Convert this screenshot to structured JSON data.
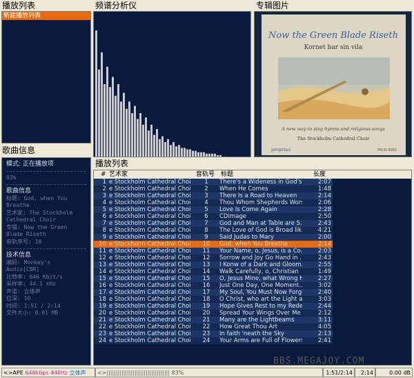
{
  "panels": {
    "playlist_title": "播放列表",
    "spectrum_title": "频谱分析仪",
    "album_title": "专辑图片",
    "song_info_title": "歌曲信息",
    "table_title": "播放列表"
  },
  "playlist": {
    "items": [
      "新建播放列表"
    ]
  },
  "album": {
    "title": "Now the Green Blade Riseth",
    "subtitle": "Kornet har sin vila",
    "tagline": "A new way to sing hymns and religious songs",
    "performer": "The Stockholm Cathedral Choir",
    "label": "proprius",
    "catalog": "PRCD 9092"
  },
  "song_info": {
    "mode_label": "模式:",
    "mode_value": "正在播放项",
    "counter": "03%",
    "song_heading": "歌曲信息",
    "title_label": "标题:",
    "title_value": "God, when You Breathe",
    "artist_label": "艺术家:",
    "artist_value": "The Stockholm Cathedral Choir",
    "album_label": "专辑:",
    "album_value": "Now the Green Blade Riseth",
    "track_label": "音轨序号:",
    "track_value": "10",
    "tech_heading": "技术信息",
    "codec_label": "编码:",
    "codec_value": "Monkey's Audio[CBR]",
    "bitrate_label": "比特率:",
    "bitrate_value": "646 Kbit/s",
    "samplerate_label": "采样率:",
    "samplerate_value": "44.1 kHz",
    "channels_label": "声道:",
    "channels_value": "立体声",
    "bits_label": "位深:",
    "bits_value": "16",
    "time_label": "时间:",
    "time_value": "1:51 / 2:14",
    "filesize_label": "文件大小:",
    "filesize_value": "0.01 MB"
  },
  "table": {
    "headers": {
      "num": "#",
      "artist": "艺术家",
      "track": "音轨号",
      "title": "标题",
      "length": "长度"
    },
    "selected_index": 9,
    "rows": [
      {
        "num": "1",
        "artist": "e Stockholm Cathedral Choir",
        "track": "1",
        "title": "There's a Wideness in God's...",
        "length": "2:07"
      },
      {
        "num": "2",
        "artist": "e Stockholm Cathedral Choir",
        "track": "2",
        "title": "When He Comes",
        "length": "1:48"
      },
      {
        "num": "3",
        "artist": "e Stockholm Cathedral Choir",
        "track": "3",
        "title": "There Is a Road to Heaven",
        "length": "2:14"
      },
      {
        "num": "4",
        "artist": "e Stockholm Cathedral Choir",
        "track": "4",
        "title": "Thou Whom Shepherds Wors...",
        "length": "2:06"
      },
      {
        "num": "5",
        "artist": "e Stockholm Cathedral Choir",
        "track": "5",
        "title": "Love Is Come Again",
        "length": "2:28"
      },
      {
        "num": "6",
        "artist": "e Stockholm Cathedral Choir",
        "track": "6",
        "title": "CDImage",
        "length": "2:50"
      },
      {
        "num": "7",
        "artist": "e Stockholm Cathedral Choir",
        "track": "7",
        "title": "God and Man at Table are S...",
        "length": "2:43"
      },
      {
        "num": "8",
        "artist": "e Stockholm Cathedral Choir",
        "track": "8",
        "title": "The Love of God is Broad lik...",
        "length": "4:21"
      },
      {
        "num": "9",
        "artist": "e Stockholm Cathedral Choir",
        "track": "9",
        "title": "Said Judas to Mary",
        "length": "2:00"
      },
      {
        "num": "10",
        "artist": "e Stockholm Cathedral Choir",
        "track": "10",
        "title": "God, when You Breathe",
        "length": "2:14"
      },
      {
        "num": "11",
        "artist": "e Stockholm Cathedral Choir",
        "track": "11",
        "title": "Your Name, o, Jesus, is a Co...",
        "length": "2:03"
      },
      {
        "num": "12",
        "artist": "e Stockholm Cathedral Choir",
        "track": "12",
        "title": "Sorrow and Joy Go Hand in ...",
        "length": "2:43"
      },
      {
        "num": "13",
        "artist": "e Stockholm Cathedral Choir",
        "track": "13",
        "title": "I Konw of a Dark and Gloom...",
        "length": "2:55"
      },
      {
        "num": "14",
        "artist": "e Stockholm Cathedral Choir",
        "track": "14",
        "title": "Walk Carefully, o, Christian",
        "length": "1:49"
      },
      {
        "num": "15",
        "artist": "e Stockholm Cathedral Choir",
        "track": "15",
        "title": "O, Jesus Mine, what Wrong H...",
        "length": "2:27"
      },
      {
        "num": "16",
        "artist": "e Stockholm Cathedral Choir",
        "track": "16",
        "title": "Just One Day, One Moment...",
        "length": "3:02"
      },
      {
        "num": "17",
        "artist": "e Stockholm Cathedral Choir",
        "track": "17",
        "title": "My Soul, You Must Now Forget",
        "length": "2:40"
      },
      {
        "num": "18",
        "artist": "e Stockholm Cathedral Choir",
        "track": "18",
        "title": "O Christ, who art the Light a...",
        "length": "3:03"
      },
      {
        "num": "19",
        "artist": "e Stockholm Cathedral Choir",
        "track": "19",
        "title": "Hope Gives Rest to my Rede...",
        "length": "2:44"
      },
      {
        "num": "20",
        "artist": "e Stockholm Cathedral Choir",
        "track": "20",
        "title": "Spread Your Wings Over Me",
        "length": "2:12"
      },
      {
        "num": "21",
        "artist": "e Stockholm Cathedral Choir",
        "track": "21",
        "title": "Many are the Lightbeams",
        "length": "3:11"
      },
      {
        "num": "22",
        "artist": "e Stockholm Cathedral Choir",
        "track": "22",
        "title": "How Great Thou Art",
        "length": "4:05"
      },
      {
        "num": "23",
        "artist": "e Stockholm Cathedral Choir",
        "track": "23",
        "title": "In faith 'neath the Sky",
        "length": "2:13"
      },
      {
        "num": "24",
        "artist": "e Stockholm Cathedral Choir",
        "track": "24",
        "title": "Your Arms are Full of Flowers",
        "length": "2:41"
      }
    ]
  },
  "spectrum": {
    "levels": [
      0.87,
      0.6,
      0.72,
      0.5,
      0.62,
      0.48,
      0.55,
      0.42,
      0.5,
      0.38,
      0.44,
      0.33,
      0.38,
      0.3,
      0.35,
      0.26,
      0.3,
      0.22,
      0.27,
      0.18,
      0.22,
      0.15,
      0.19,
      0.12,
      0.14,
      0.1,
      0.12,
      0.08,
      0.1,
      0.07,
      0.08,
      0.06,
      0.06,
      0.05,
      0.05,
      0.04,
      0.04,
      0.03,
      0.03,
      0.03,
      0.02,
      0.02,
      0.02,
      0.02,
      0.01,
      0.01
    ]
  },
  "status": {
    "codec": "<>APE",
    "bitrate": "646kbps",
    "samplerate": "44kHz",
    "channels": "立体声",
    "progress_text": "<>|||||||||||||||||||||||||||||||||| 83%",
    "progress_fraction": 0.83,
    "time": "1:51/2:14",
    "total": "2:14",
    "volume": "0.00 dB",
    "watermark": "BBS.MEGAJOY.COM"
  },
  "colors": {
    "accent": "#e46b12",
    "panel_bg": "#0a1a3e",
    "row_odd": "#1e3766",
    "row_even": "#142a52"
  }
}
